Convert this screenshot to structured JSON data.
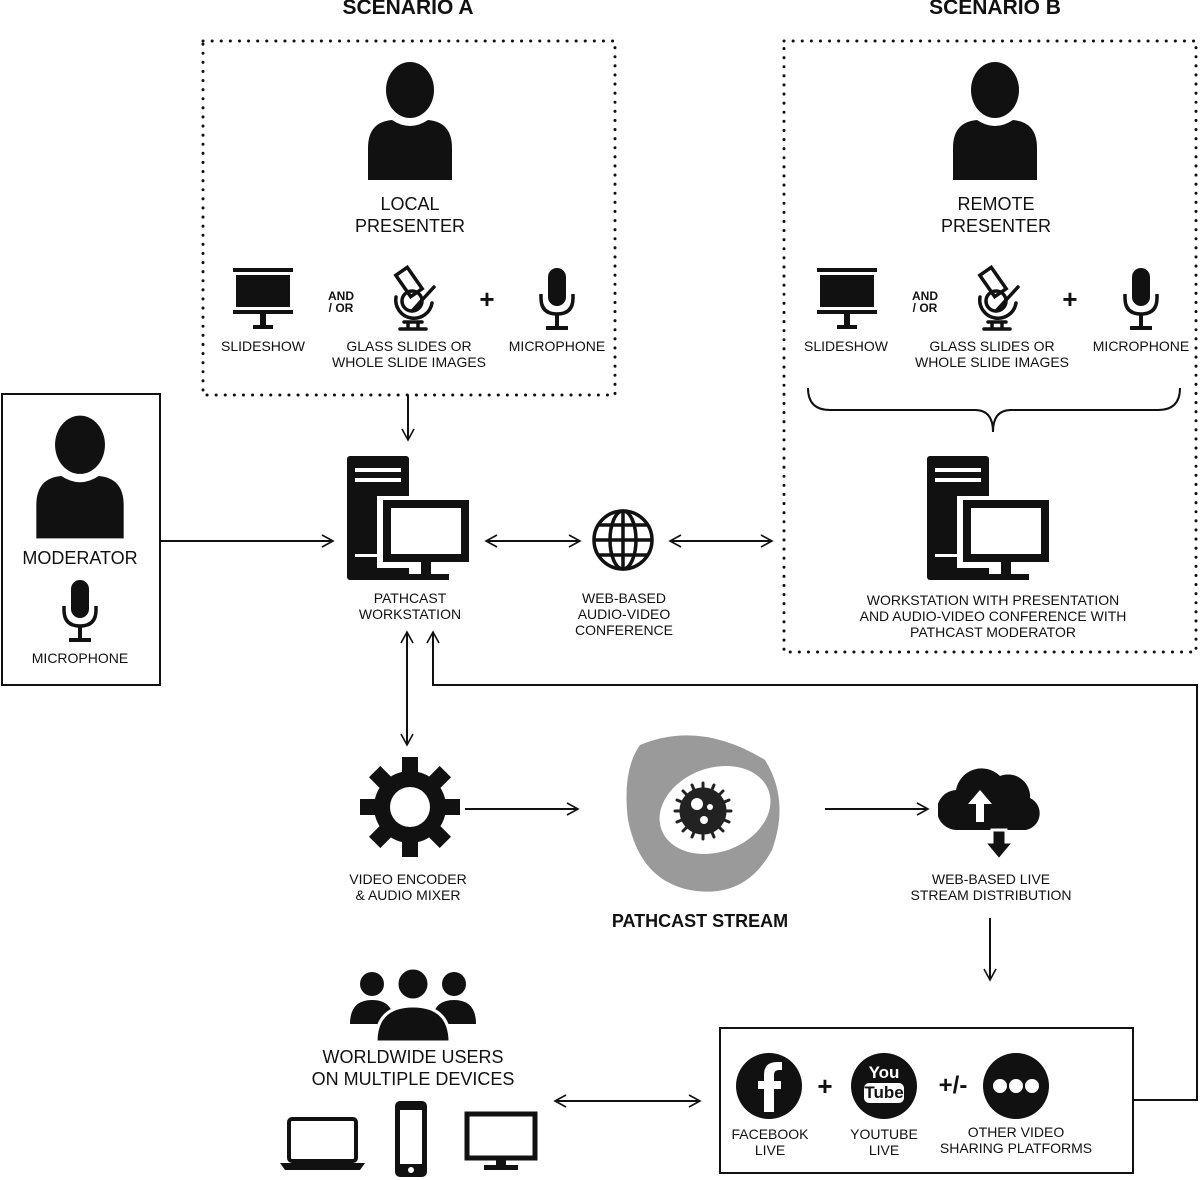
{
  "scenario_a": {
    "title": "SCENARIO A",
    "presenter": [
      "LOCAL",
      "PRESENTER"
    ],
    "slideshow": "SLIDESHOW",
    "and_or": [
      "AND",
      "/ OR"
    ],
    "slides": [
      "GLASS SLIDES OR",
      "WHOLE SLIDE IMAGES"
    ],
    "plus": "+",
    "microphone": "MICROPHONE"
  },
  "scenario_b": {
    "title": "SCENARIO B",
    "presenter": [
      "REMOTE",
      "PRESENTER"
    ],
    "slideshow": "SLIDESHOW",
    "and_or": [
      "AND",
      "/ OR"
    ],
    "slides": [
      "GLASS SLIDES OR",
      "WHOLE SLIDE IMAGES"
    ],
    "plus": "+",
    "microphone": "MICROPHONE",
    "workstation": [
      "WORKSTATION WITH PRESENTATION",
      "AND AUDIO-VIDEO CONFERENCE WITH",
      "PATHCAST MODERATOR"
    ]
  },
  "moderator": {
    "label": "MODERATOR",
    "microphone": "MICROPHONE"
  },
  "workstation": [
    "PATHCAST",
    "WORKSTATION"
  ],
  "conference": [
    "WEB-BASED",
    "AUDIO-VIDEO",
    "CONFERENCE"
  ],
  "encoder": [
    "VIDEO ENCODER",
    "& AUDIO MIXER"
  ],
  "logo": {
    "title": "PATHCAST STREAM",
    "ring_color": "#9a9a9a"
  },
  "distribution": [
    "WEB-BASED LIVE",
    "STREAM DISTRIBUTION"
  ],
  "users": [
    "WORLDWIDE USERS",
    "ON MULTIPLE DEVICES"
  ],
  "platforms": {
    "facebook": [
      "FACEBOOK",
      "LIVE"
    ],
    "plus": "+",
    "youtube": [
      "YOUTUBE",
      "LIVE"
    ],
    "youtube_logo": [
      "You",
      "Tube"
    ],
    "plus_minus": "+/-",
    "other": [
      "OTHER VIDEO",
      "SHARING PLATFORMS"
    ]
  }
}
